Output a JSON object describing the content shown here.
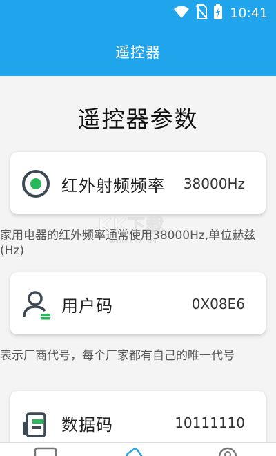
{
  "status_bar": {
    "time": "10:41",
    "icons": [
      "wifi-icon",
      "no-sim-icon",
      "battery-charging-icon"
    ]
  },
  "app_bar": {
    "title": "遥控器"
  },
  "page": {
    "title": "遥控器参数"
  },
  "params": [
    {
      "label": "红外射频频率",
      "value": "38000Hz",
      "icon": "radio-circle-icon",
      "description": "家用电器的红外频率通常使用38000Hz,单位赫兹(Hz)"
    },
    {
      "label": "用户码",
      "value": "0X08E6",
      "icon": "user-icon",
      "description": "表示厂商代号，每个厂家都有自己的唯一代号"
    },
    {
      "label": "数据码",
      "value": "10111110",
      "icon": "data-card-icon"
    }
  ],
  "watermark": {
    "main": "KK下载",
    "sub": "www.kkx.net"
  },
  "bottom_nav": {
    "items": [
      "tv-icon",
      "remote-icon",
      "profile-icon"
    ],
    "active": 1
  },
  "colors": {
    "primary": "#20a4ec",
    "icon_dark": "#3d4a55",
    "icon_green": "#28b85a",
    "background": "#f4f4f4"
  }
}
